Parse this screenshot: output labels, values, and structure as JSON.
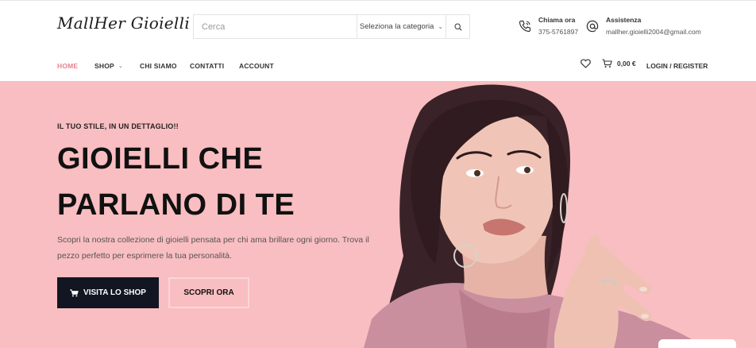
{
  "header": {
    "logo": "MallHer Gioielli",
    "search": {
      "placeholder": "Cerca",
      "value": ""
    },
    "category_select": "Seleziona la categoria",
    "phone": {
      "title": "Chiama ora",
      "value": "375-5761897",
      "icon": "phone-icon"
    },
    "support": {
      "title": "Assistenza",
      "value": "mallher.gioielli2004@gmail.com",
      "icon": "at-icon"
    }
  },
  "nav": {
    "items": [
      {
        "label": "HOME",
        "active": true
      },
      {
        "label": "SHOP",
        "has_dropdown": true
      },
      {
        "label": "CHI SIAMO"
      },
      {
        "label": "CONTATTI"
      },
      {
        "label": "ACCOUNT"
      }
    ],
    "cart_total": "0,00 €",
    "login": "LOGIN / REGISTER"
  },
  "hero": {
    "tagline": "IL TUO STILE, IN UN DETTAGLIO!!",
    "headline_line1": "GIOIELLI CHE",
    "headline_line2": "PARLANO DI TE",
    "description": "Scopri la nostra collezione di gioielli pensata per chi ama brillare ogni giorno. Trova il pezzo perfetto per esprimere la tua personalità.",
    "primary_button": "VISITA LO SHOP",
    "secondary_button": "SCOPRI ORA",
    "background_color": "#f9bec1"
  },
  "colors": {
    "accent": "#e8838d",
    "dark_button": "#111622"
  }
}
